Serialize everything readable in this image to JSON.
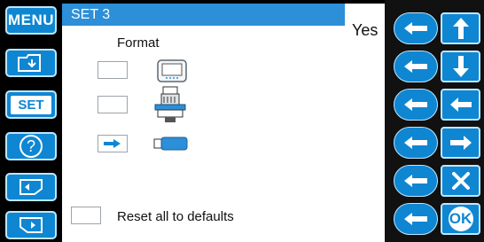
{
  "left_nav": {
    "menu_label": "MENU",
    "set_label": "SET",
    "help_label": "?"
  },
  "title": "SET 3",
  "format_label": "Format",
  "options": [
    {
      "name": "machine-display",
      "icon": "lcd-display-icon",
      "selected": false
    },
    {
      "name": "embroidery-machine",
      "icon": "embroidery-machine-icon",
      "selected": false
    },
    {
      "name": "usb-memory",
      "icon": "usb-stick-icon",
      "selected": true
    }
  ],
  "reset_label": "Reset all to defaults",
  "yes_label": "Yes",
  "nav_buttons": [
    "arrow-up",
    "arrow-down",
    "arrow-left",
    "arrow-right",
    "close"
  ],
  "ok_label": "OK",
  "colors": {
    "accent": "#0f86d2",
    "title_bar": "#2c8fd8",
    "background": "#000000"
  }
}
